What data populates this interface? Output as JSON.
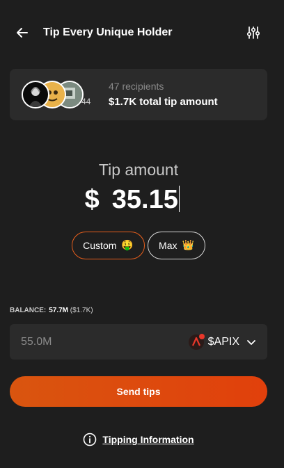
{
  "header": {
    "title": "Tip Every Unique Holder",
    "back_icon": "arrow-left-icon",
    "settings_icon": "sliders-icon"
  },
  "recipients": {
    "extra_count": "+44",
    "count_text": "47 recipients",
    "total_text": "$1.7K total tip amount"
  },
  "tip": {
    "label": "Tip amount",
    "currency_symbol": "$",
    "amount": "35.15"
  },
  "chips": {
    "custom_label": "Custom",
    "custom_emoji": "🤑",
    "max_label": "Max",
    "max_emoji": "👑"
  },
  "balance": {
    "label": "BALANCE:",
    "value": "57.7M",
    "fiat": "($1.7K)"
  },
  "token_input": {
    "placeholder": "55.0M",
    "token_name": "$APIX"
  },
  "send_button": {
    "label": "Send tips"
  },
  "info_link": {
    "label": "Tipping Information"
  },
  "colors": {
    "background": "#1e1e1e",
    "card": "#2b2b2b",
    "accent": "#e1400c",
    "custom_border": "#e85f1c"
  }
}
